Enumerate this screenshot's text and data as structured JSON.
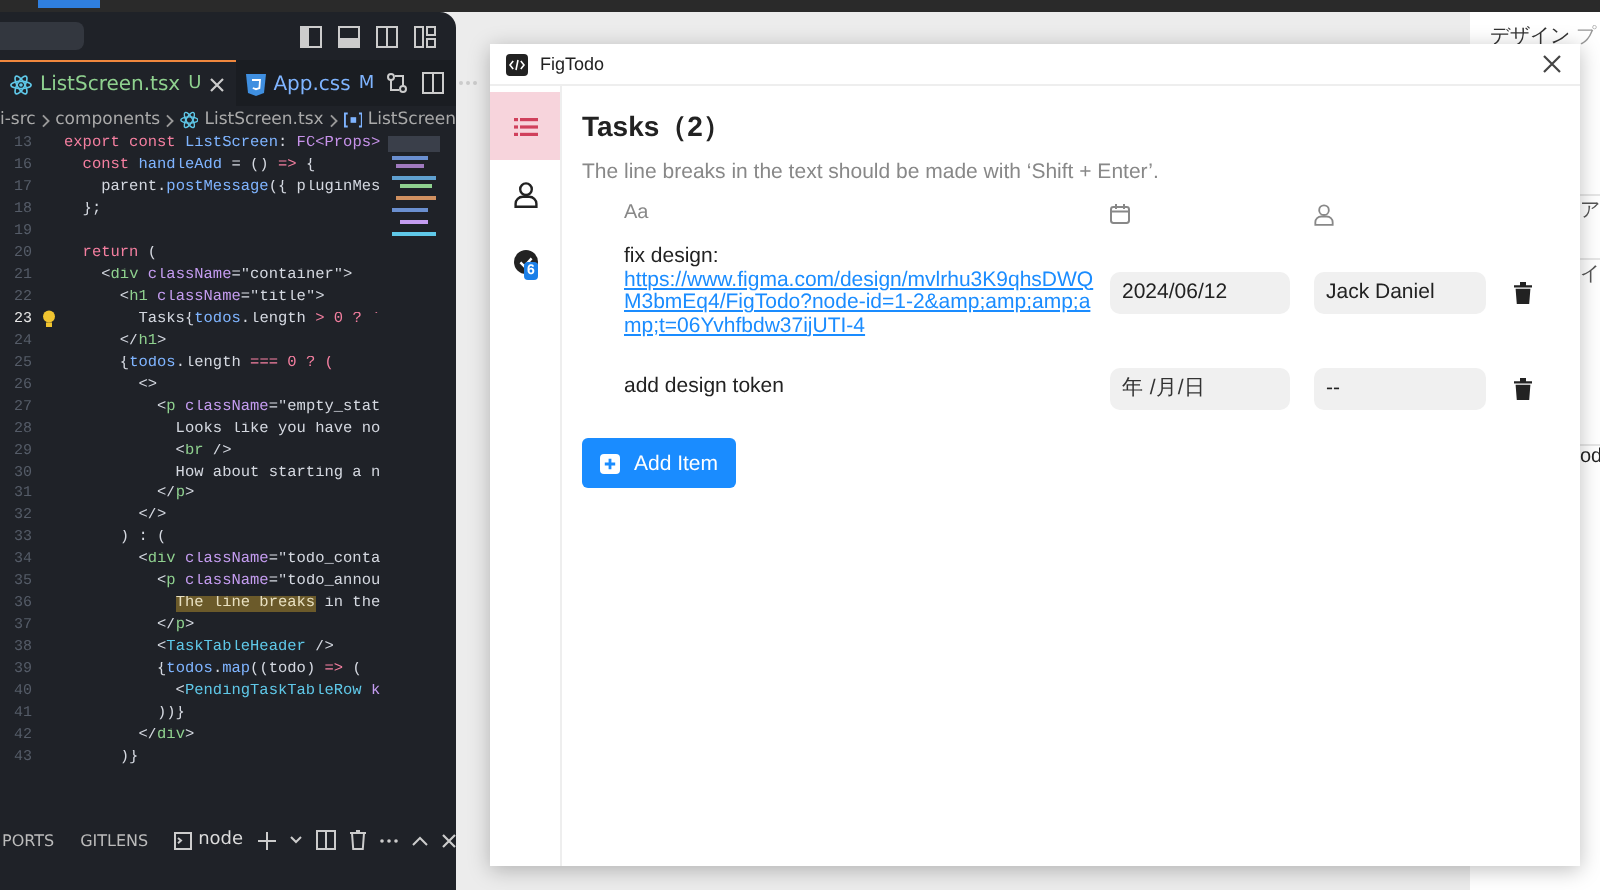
{
  "editor": {
    "tabs": [
      {
        "label": "ListScreen.tsx",
        "status": "U",
        "selected": true,
        "kind": "react"
      },
      {
        "label": "App.css",
        "status": "M",
        "selected": false,
        "kind": "css"
      }
    ],
    "breadcrumb": [
      {
        "label": "i-src",
        "kind": "folder"
      },
      {
        "label": "components",
        "kind": "folder"
      },
      {
        "label": "ListScreen.tsx",
        "kind": "react"
      },
      {
        "label": "ListScreen",
        "kind": "symbol"
      }
    ],
    "lines": [
      {
        "number": "13",
        "current": false,
        "tokens": [
          {
            "text": "export const ",
            "kind": "kw"
          },
          {
            "text": "ListScreen",
            "kind": "fn"
          },
          {
            "text": ": ",
            "kind": "p"
          },
          {
            "text": "FC<Props>",
            "kind": "type"
          }
        ]
      },
      {
        "number": "16",
        "current": false,
        "tokens": [
          {
            "text": "  const ",
            "kind": "kw"
          },
          {
            "text": "handleAdd",
            "kind": "fn"
          },
          {
            "text": " = () ",
            "kind": "p"
          },
          {
            "text": "=>",
            "kind": "kw"
          },
          {
            "text": " {",
            "kind": "p"
          }
        ]
      },
      {
        "number": "17",
        "current": false,
        "tokens": [
          {
            "text": "    parent.",
            "kind": "p"
          },
          {
            "text": "postMessage",
            "kind": "fn"
          },
          {
            "text": "({ pluginMes",
            "kind": "p"
          }
        ]
      },
      {
        "number": "18",
        "current": false,
        "tokens": [
          {
            "text": "  };",
            "kind": "p"
          }
        ]
      },
      {
        "number": "19",
        "current": false
      },
      {
        "number": "20",
        "current": false,
        "tokens": [
          {
            "text": "  return ",
            "kind": "kw"
          },
          {
            "text": "(",
            "kind": "p"
          }
        ]
      },
      {
        "number": "21",
        "current": false,
        "tokens": [
          {
            "text": "    <",
            "kind": "p"
          },
          {
            "text": "div",
            "kind": "tag"
          },
          {
            "text": " className",
            "kind": "attr"
          },
          {
            "text": "=\"container\">",
            "kind": "str"
          }
        ]
      },
      {
        "number": "22",
        "current": false,
        "tokens": [
          {
            "text": "      <",
            "kind": "p"
          },
          {
            "text": "h1",
            "kind": "tag"
          },
          {
            "text": " className",
            "kind": "attr"
          },
          {
            "text": "=\"title\">",
            "kind": "str"
          }
        ]
      },
      {
        "number": "23",
        "current": true,
        "tokens": [
          {
            "text": "        Tasks{",
            "kind": "p"
          },
          {
            "text": "todos",
            "kind": "fn"
          },
          {
            "text": ".length ",
            "kind": "p"
          },
          {
            "text": "> 0 ? `",
            "kind": "kw"
          }
        ]
      },
      {
        "number": "24",
        "current": false,
        "tokens": [
          {
            "text": "      </",
            "kind": "p"
          },
          {
            "text": "h1",
            "kind": "tag"
          },
          {
            "text": ">",
            "kind": "p"
          }
        ]
      },
      {
        "number": "25",
        "current": false,
        "tokens": [
          {
            "text": "      {",
            "kind": "p"
          },
          {
            "text": "todos",
            "kind": "fn"
          },
          {
            "text": ".length ",
            "kind": "p"
          },
          {
            "text": "=== 0 ? (",
            "kind": "kw"
          }
        ]
      },
      {
        "number": "26",
        "current": false,
        "tokens": [
          {
            "text": "        <>",
            "kind": "p"
          }
        ]
      },
      {
        "number": "27",
        "current": false,
        "tokens": [
          {
            "text": "          <",
            "kind": "p"
          },
          {
            "text": "p",
            "kind": "tag"
          },
          {
            "text": " className",
            "kind": "attr"
          },
          {
            "text": "=\"empty_stat",
            "kind": "str"
          }
        ]
      },
      {
        "number": "28",
        "current": false,
        "tokens": [
          {
            "text": "            Looks like you have no",
            "kind": "p"
          }
        ]
      },
      {
        "number": "29",
        "current": false,
        "tokens": [
          {
            "text": "            <",
            "kind": "p"
          },
          {
            "text": "br",
            "kind": "tag"
          },
          {
            "text": " />",
            "kind": "p"
          }
        ]
      },
      {
        "number": "30",
        "current": false,
        "tokens": [
          {
            "text": "            How about starting a n",
            "kind": "p"
          }
        ]
      },
      {
        "number": "31",
        "current": false,
        "tokens": [
          {
            "text": "          </",
            "kind": "p"
          },
          {
            "text": "p",
            "kind": "tag"
          },
          {
            "text": ">",
            "kind": "p"
          }
        ]
      },
      {
        "number": "32",
        "current": false,
        "tokens": [
          {
            "text": "        </>",
            "kind": "p"
          }
        ]
      },
      {
        "number": "33",
        "current": false,
        "tokens": [
          {
            "text": "      ) : (",
            "kind": "p"
          }
        ]
      },
      {
        "number": "34",
        "current": false,
        "tokens": [
          {
            "text": "        <",
            "kind": "p"
          },
          {
            "text": "div",
            "kind": "tag"
          },
          {
            "text": " className",
            "kind": "attr"
          },
          {
            "text": "=\"todo_conta",
            "kind": "str"
          }
        ]
      },
      {
        "number": "35",
        "current": false,
        "tokens": [
          {
            "text": "          <",
            "kind": "p"
          },
          {
            "text": "p",
            "kind": "tag"
          },
          {
            "text": " className",
            "kind": "attr"
          },
          {
            "text": "=\"todo_annou",
            "kind": "str"
          }
        ]
      },
      {
        "number": "36",
        "current": false,
        "tokens": [
          {
            "text": "            The line breaks",
            "kind": "mark"
          },
          {
            "text": " in the",
            "kind": "p"
          }
        ]
      },
      {
        "number": "37",
        "current": false,
        "tokens": [
          {
            "text": "          </",
            "kind": "p"
          },
          {
            "text": "p",
            "kind": "tag"
          },
          {
            "text": ">",
            "kind": "p"
          }
        ]
      },
      {
        "number": "38",
        "current": false,
        "tokens": [
          {
            "text": "          <",
            "kind": "p"
          },
          {
            "text": "TaskTableHeader",
            "kind": "comp"
          },
          {
            "text": " />",
            "kind": "p"
          }
        ]
      },
      {
        "number": "39",
        "current": false,
        "tokens": [
          {
            "text": "          {",
            "kind": "p"
          },
          {
            "text": "todos",
            "kind": "fn"
          },
          {
            "text": ".",
            "kind": "p"
          },
          {
            "text": "map",
            "kind": "fn"
          },
          {
            "text": "((todo) ",
            "kind": "p"
          },
          {
            "text": "=>",
            "kind": "kw"
          },
          {
            "text": " (",
            "kind": "p"
          }
        ]
      },
      {
        "number": "40",
        "current": false,
        "tokens": [
          {
            "text": "            <",
            "kind": "p"
          },
          {
            "text": "PendingTaskTableRow",
            "kind": "comp"
          },
          {
            "text": " k",
            "kind": "attr"
          }
        ]
      },
      {
        "number": "41",
        "current": false,
        "tokens": [
          {
            "text": "          ))}",
            "kind": "p"
          }
        ]
      },
      {
        "number": "42",
        "current": false,
        "tokens": [
          {
            "text": "        </",
            "kind": "p"
          },
          {
            "text": "div",
            "kind": "tag"
          },
          {
            "text": ">",
            "kind": "p"
          }
        ]
      },
      {
        "number": "43",
        "current": false,
        "tokens": [
          {
            "text": "      )}",
            "kind": "p"
          }
        ]
      }
    ],
    "panel": {
      "tabs": [
        "PORTS",
        "GITLENS"
      ],
      "terminal": "node"
    }
  },
  "background_app": {
    "tabs": [
      "デザイン",
      "プ"
    ],
    "fragments": [
      "ア",
      "イ",
      "od"
    ]
  },
  "plugin": {
    "title": "FigTodo",
    "nav": [
      {
        "kind": "list",
        "selected": true
      },
      {
        "kind": "person",
        "selected": false
      },
      {
        "kind": "check",
        "selected": false,
        "badge": "6"
      }
    ],
    "heading": "Tasks（2）",
    "note": "The line breaks in the text should be made with ‘Shift + Enter’.",
    "title_column": "Aa",
    "tasks": [
      {
        "title": "fix design:",
        "link": "https://www.figma.com/design/mvlrhu3K9qhsDWQM3bmEq4/FigTodo?node-id=1-2&amp;amp;amp;amp;t=06Yvhfbdw37ijUTI-4",
        "date": "2024/06/12",
        "assignee": "Jack Daniel"
      },
      {
        "title": "add design token",
        "date_placeholder": "年 /月/日",
        "assignee": "--"
      }
    ],
    "add_button": "Add Item"
  }
}
